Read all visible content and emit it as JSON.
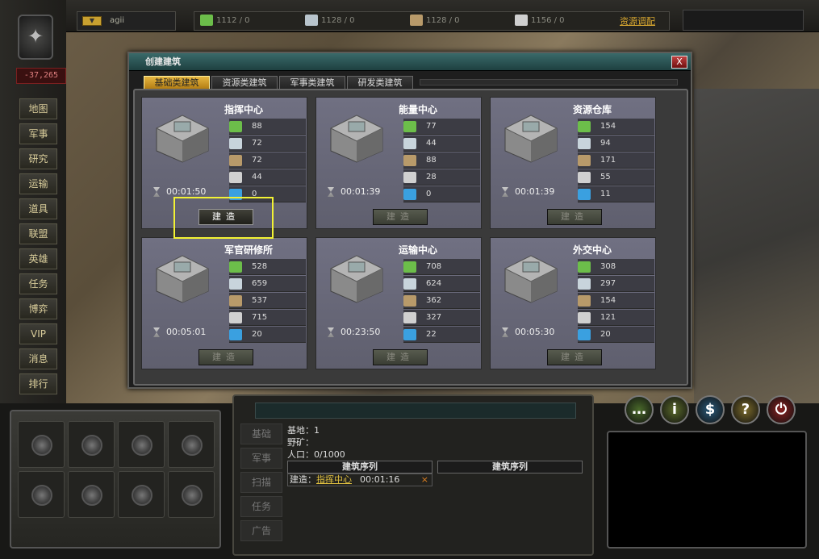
{
  "player": {
    "name": "agii",
    "coords": "-37,265"
  },
  "resources": [
    {
      "icon": "crystal-icon",
      "value": "1112 / 0",
      "color": "#6cbe4a"
    },
    {
      "icon": "ore-icon",
      "value": "1128 / 0",
      "color": "#b8c4cc"
    },
    {
      "icon": "supply-icon",
      "value": "1128 / 0",
      "color": "#b89a6a"
    },
    {
      "icon": "fuel-icon",
      "value": "1156 / 0",
      "color": "#cfcfcf"
    }
  ],
  "resource_link": "资源调配",
  "nav": [
    "地图",
    "军事",
    "研究",
    "运输",
    "道具",
    "联盟",
    "英雄",
    "任务",
    "博弈",
    "VIP",
    "消息",
    "排行"
  ],
  "dialog": {
    "title": "创建建筑",
    "close": "X",
    "tabs": [
      "基础类建筑",
      "资源类建筑",
      "军事类建筑",
      "研发类建筑"
    ],
    "active_tab": 0,
    "buildings": [
      {
        "name": "指挥中心",
        "costs": [
          "88",
          "72",
          "72",
          "44",
          "0"
        ],
        "time": "00:01:50",
        "button": "建造",
        "enabled": true
      },
      {
        "name": "能量中心",
        "costs": [
          "77",
          "44",
          "88",
          "28",
          "0"
        ],
        "time": "00:01:39",
        "button": "建造",
        "enabled": false
      },
      {
        "name": "资源仓库",
        "costs": [
          "154",
          "94",
          "171",
          "55",
          "11"
        ],
        "time": "00:01:39",
        "button": "建造",
        "enabled": false
      },
      {
        "name": "军官研修所",
        "costs": [
          "528",
          "659",
          "537",
          "715",
          "20"
        ],
        "time": "00:05:01",
        "button": "建造",
        "enabled": false
      },
      {
        "name": "运输中心",
        "costs": [
          "708",
          "624",
          "362",
          "327",
          "22"
        ],
        "time": "00:23:50",
        "button": "建造",
        "enabled": false
      },
      {
        "name": "外交中心",
        "costs": [
          "308",
          "297",
          "154",
          "121",
          "20"
        ],
        "time": "00:05:30",
        "button": "建造",
        "enabled": false
      }
    ]
  },
  "console": {
    "tabs": [
      "基础",
      "军事",
      "扫描",
      "任务",
      "广告"
    ],
    "base_line": "基地：1",
    "wild_line": "野矿：",
    "pop_line": "人口：0/1000",
    "queue_headers": [
      "建筑序列",
      "建筑序列"
    ],
    "queue_item": {
      "prefix": "建造：",
      "name": "指挥中心",
      "time": "00:01:16",
      "cancel": "×"
    }
  },
  "round_buttons": [
    {
      "icon": "chat-icon",
      "glyph": "…",
      "color": "#4a6a2a"
    },
    {
      "icon": "info-icon",
      "glyph": "i",
      "color": "#5a6a2a"
    },
    {
      "icon": "money-icon",
      "glyph": "$",
      "color": "#2a5a7a"
    },
    {
      "icon": "help-icon",
      "glyph": "?",
      "color": "#7a6a2a"
    },
    {
      "icon": "power-icon",
      "glyph": "⏻",
      "color": "#8a2020"
    }
  ]
}
